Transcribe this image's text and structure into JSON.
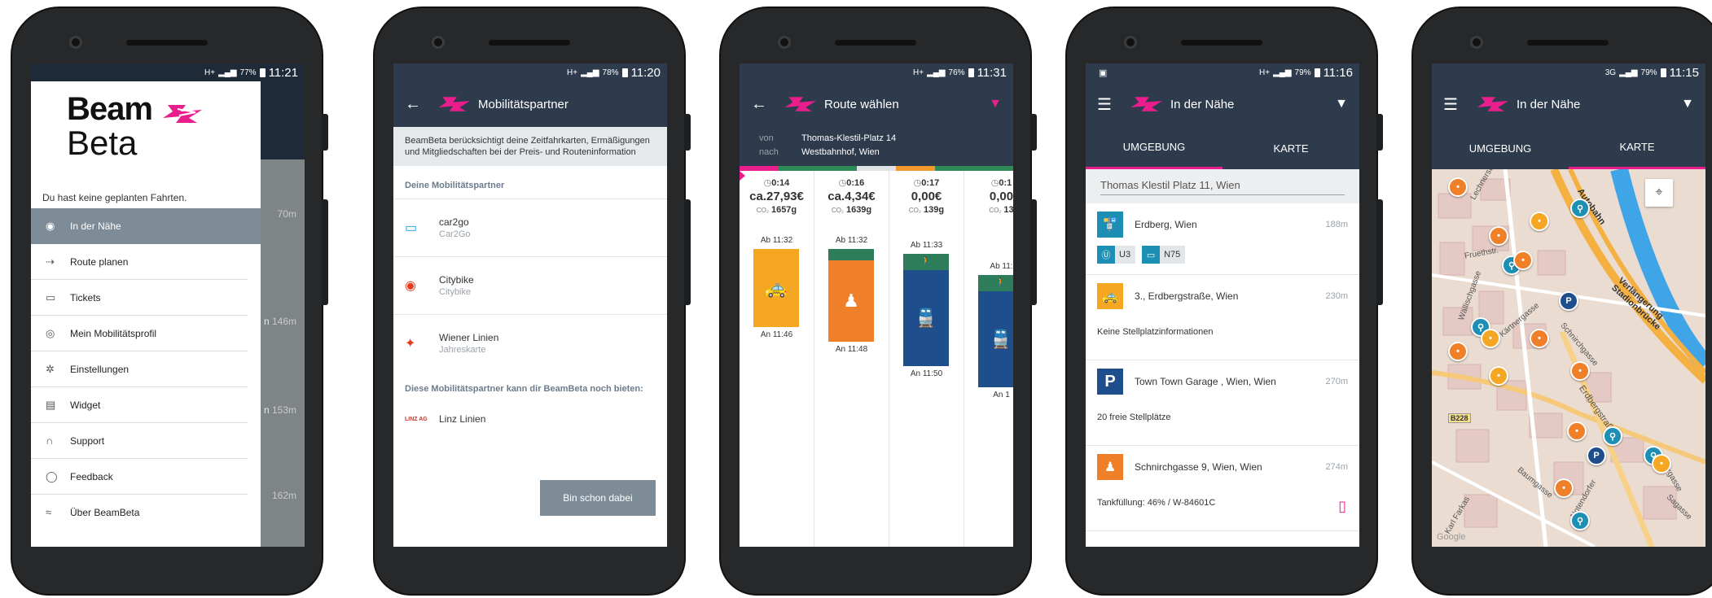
{
  "status": [
    {
      "time": "11:21",
      "batt": "77%",
      "net": "H+"
    },
    {
      "time": "11:20",
      "batt": "78%",
      "net": "H+"
    },
    {
      "time": "11:31",
      "batt": "76%",
      "net": "H+"
    },
    {
      "time": "11:16",
      "batt": "79%",
      "net": "H+"
    },
    {
      "time": "11:15",
      "batt": "79%",
      "net": "3G"
    }
  ],
  "colors": {
    "accent": "#e91e8c",
    "bar": "#2d3b4d"
  },
  "drawer": {
    "brand1": "Beam",
    "brand2": "Beta",
    "no_trips": "Du hast keine geplanten Fahrten.",
    "items": [
      {
        "label": "In der Nähe",
        "icon": "location-icon"
      },
      {
        "label": "Route planen",
        "icon": "route-icon"
      },
      {
        "label": "Tickets",
        "icon": "tickets-icon"
      },
      {
        "label": "Mein Mobilitätsprofil",
        "icon": "profile-icon"
      },
      {
        "label": "Einstellungen",
        "icon": "settings-icon"
      },
      {
        "label": "Widget",
        "icon": "widget-icon"
      },
      {
        "label": "Support",
        "icon": "headset-icon"
      },
      {
        "label": "Feedback",
        "icon": "feedback-icon"
      },
      {
        "label": "Über BeamBeta",
        "icon": "info-icon"
      }
    ],
    "bg_distances": [
      "70m",
      "146m",
      "153m",
      "162m"
    ],
    "bg_prefix": [
      "n",
      "n"
    ]
  },
  "partners": {
    "title": "Mobilitätspartner",
    "intro": "BeamBeta berücksichtigt deine Zeitfahrkarten, Ermäßigungen und Mitgliedschaften bei der Preis- und Routeninformation",
    "section1": "Deine Mobilitätspartner",
    "items": [
      {
        "name": "car2go",
        "sub": "Car2Go"
      },
      {
        "name": "Citybike",
        "sub": "Citybike"
      },
      {
        "name": "Wiener Linien",
        "sub": "Jahreskarte"
      }
    ],
    "section2": "Diese Mobilitätspartner kann dir BeamBeta noch bieten:",
    "others": [
      {
        "name": "Linz Linien"
      }
    ],
    "button": "Bin schon dabei"
  },
  "route": {
    "title": "Route wählen",
    "from_label": "von",
    "from": "Thomas-Klestil-Platz 14",
    "to_label": "nach",
    "to": "Westbahnhof, Wien",
    "options": [
      {
        "duration": "0:14",
        "price": "ca.27,93€",
        "co2": "1657g",
        "ab": "Ab 11:32",
        "an": "An 11:46"
      },
      {
        "duration": "0:16",
        "price": "ca.4,34€",
        "co2": "1639g",
        "ab": "Ab 11:32",
        "an": "An 11:48"
      },
      {
        "duration": "0:17",
        "price": "0,00€",
        "co2": "139g",
        "ab": "Ab 11:33",
        "an": "An 11:50"
      },
      {
        "duration": "0:1",
        "price": "0,00",
        "co2": "13",
        "ab": "Ab 11:",
        "an": "An 1"
      }
    ],
    "co2_label": "CO₂"
  },
  "nearby": {
    "title": "In der Nähe",
    "tab1": "UMGEBUNG",
    "tab2": "KARTE",
    "search": "Thomas Klestil Platz 11, Wien",
    "items": [
      {
        "name": "Erdberg, Wien",
        "dist": "188m",
        "lines": [
          "U3",
          "N75"
        ]
      },
      {
        "name": "3., Erdbergstraße, Wien",
        "dist": "230m",
        "info": "Keine Stellplatzinformationen"
      },
      {
        "name": "Town Town Garage , Wien, Wien",
        "dist": "270m",
        "info": "20 freie Stellplätze"
      },
      {
        "name": "Schnirchgasse 9, Wien, Wien",
        "dist": "274m",
        "info": "Tankfüllung: 46% / W-84601C"
      }
    ]
  },
  "map": {
    "title": "In der Nähe",
    "tab1": "UMGEBUNG",
    "tab2": "KARTE",
    "labels": [
      "Lechnerstr.",
      "Fruethstr.",
      "Wällischgasse",
      "Kärtnergasse",
      "Schnirchgasse",
      "Erdbergstraße",
      "Baumgasse",
      "Notendorfer",
      "Karl Farkas",
      "Verlängerung Stadionbrücke",
      "Autobahn",
      "B228",
      "Sagasse",
      "Drorgasse",
      "Google"
    ]
  }
}
